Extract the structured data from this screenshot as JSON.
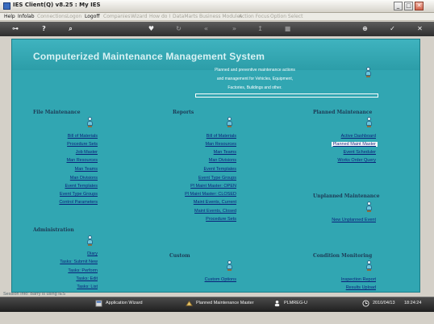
{
  "window": {
    "title": "IES Client(Q) v8.25 : My IES",
    "minimize_glyph": "_",
    "maximize_glyph": "□",
    "close_glyph": "✕"
  },
  "menubar": {
    "items": [
      "Help",
      "Infolab",
      "Connections",
      "Logon",
      "Logoff",
      "Companies",
      "Wizard",
      "How do I",
      "DataMarts",
      "Business Modules",
      "Action Focus",
      "Option Select"
    ]
  },
  "toolbar": {
    "icons": [
      "key-icon",
      "help-icon",
      "search-icon",
      "heart-icon",
      "refresh-icon",
      "rewind-icon",
      "fast-forward-icon",
      "upload-icon",
      "stop-icon",
      "add-icon",
      "check-icon",
      "close-icon"
    ]
  },
  "banner": {
    "title": "Computerized Maintenance Management System",
    "description_lines": [
      "Planned and preventive maintenance actions",
      "and management for Vehicles, Equipment,",
      "Factories, Buildings and other."
    ]
  },
  "file_maintenance": {
    "heading": "File Maintenance",
    "links": [
      "Bill of Materials",
      "Procedure Sets",
      "Job Master",
      "Man Resources",
      "Man Teams",
      "Man Divisions",
      "Event Templates",
      "Event Type Groups",
      "Control Parameters"
    ]
  },
  "reports": {
    "heading": "Reports",
    "links": [
      "Bill of Materials",
      "Man Resources",
      "Man Teams",
      "Man Divisions",
      "Event Templates",
      "Event Type Groups",
      "Pl Maint Master: OPEN",
      "Pl Maint Master: CLOSED",
      "Maint Events, Current",
      "Maint Events, Closed",
      "Procedure Sets"
    ]
  },
  "planned_maintenance": {
    "heading": "Planned Maintenance",
    "links": [
      "Active Dashboard",
      "Planned Maint Master",
      "Event Scheduler",
      "Works Order Query"
    ],
    "selected": "Planned Maint Master"
  },
  "unplanned_maintenance": {
    "heading": "Unplanned Maintenance",
    "links": [
      "New Unplanned Event"
    ]
  },
  "administration": {
    "heading": "Administration",
    "links": [
      "Diary",
      "Tasks: Submit New",
      "Tasks: Perform",
      "Tasks: Edit",
      "Tasks: List"
    ]
  },
  "custom": {
    "heading": "Custom",
    "links": [
      "Custom Options"
    ]
  },
  "condition_monitoring": {
    "heading": "Condition Monitoring",
    "links": [
      "Inspection Report",
      "Results Upload"
    ]
  },
  "session": {
    "info": "Session Info: Barry is using IES"
  },
  "taskbar": {
    "items": [
      {
        "icon": "wizard-icon",
        "label": "Application Wizard"
      },
      {
        "icon": "planned-maintenance-icon",
        "label": "Planned Maintenance Master"
      },
      {
        "icon": "user-icon",
        "label": "PLMREG-U"
      },
      {
        "icon": "clock-icon",
        "label": "2010/04/13"
      }
    ],
    "time": "18:24:24"
  },
  "colors": {
    "main_bg": "#31a6b2",
    "link": "#0a1f7a",
    "heading": "#1d3a55"
  }
}
